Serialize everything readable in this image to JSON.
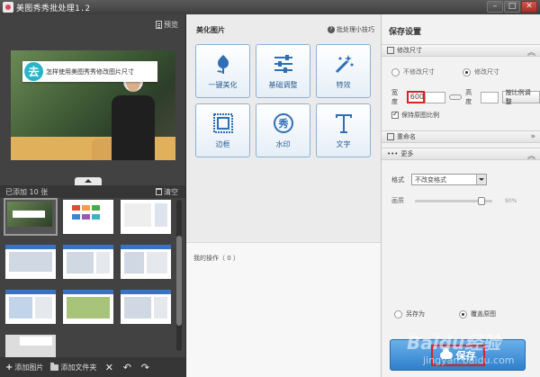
{
  "window": {
    "title": "美图秀秀批处理1.2",
    "minimize": "–",
    "maximize": "□",
    "close": "✕"
  },
  "left": {
    "preview_link": "预览",
    "preview_banner": "怎样使用美图秀秀修改图片尺寸",
    "banner_logo": "去",
    "added_count": "已添加 10 张",
    "clear": "清空",
    "add_image": "添加图片",
    "add_folder": "添加文件夹",
    "delete": "✕",
    "undo": "↶",
    "redo": "↷"
  },
  "middle": {
    "title": "美化图片",
    "tips": "批处理小技巧",
    "effects": [
      {
        "label": "一键美化"
      },
      {
        "label": "基础调整"
      },
      {
        "label": "特效"
      },
      {
        "label": "边框"
      },
      {
        "label": "水印"
      },
      {
        "label": "文字"
      }
    ],
    "ops_label": "我的操作（ 0 ）"
  },
  "right": {
    "title": "保存设置",
    "resize_section": "修改尺寸",
    "no_resize": "不修改尺寸",
    "resize": "修改尺寸",
    "width_label": "宽度",
    "width_value": "600",
    "height_label": "高度",
    "ratio_button": "按比例调整",
    "keep_ratio": "保持原图比例",
    "rename_section": "重命名",
    "more_section": "更多",
    "format_label": "格式",
    "format_value": "不改变格式",
    "quality_label": "画质",
    "quality_value": "90%",
    "quality_level": 0.9,
    "save_as": "另存为",
    "overwrite": "覆盖原图",
    "save_button": "保存"
  },
  "watermark": {
    "text": "Baidu经验",
    "sub": "jingyan.baidu.com"
  },
  "colors": {
    "accent_blue": "#3b86d2",
    "highlight_red": "#e02020",
    "dark_panel": "#424242"
  }
}
